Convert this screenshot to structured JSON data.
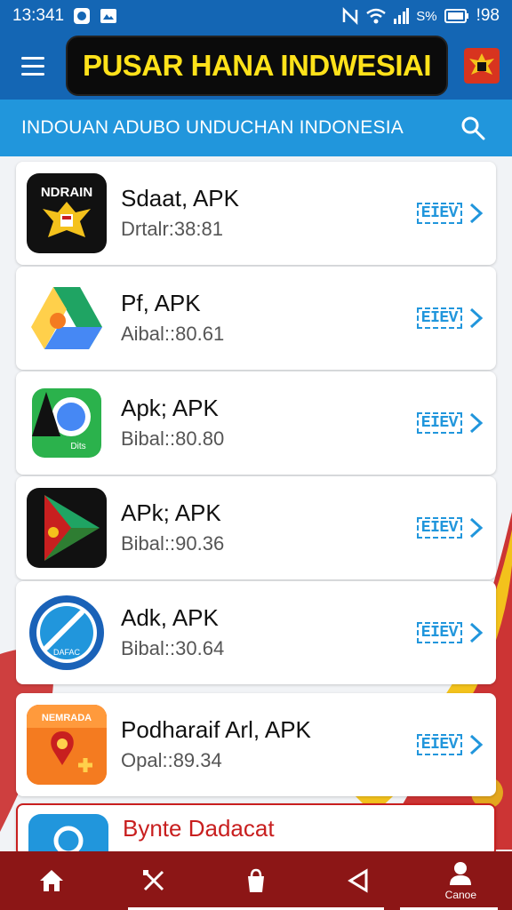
{
  "status_bar": {
    "time": "13:341",
    "battery": "98",
    "signal_pct": "S%"
  },
  "app_bar": {
    "title": "PUSAR HANA INDWESIAI",
    "menu_icon": "hamburger-icon",
    "emblem_icon": "garuda-emblem-icon"
  },
  "search_strip": {
    "label": "INDOUAN ADUBO UNDUCHAN INDONESIA",
    "icon": "search-icon"
  },
  "apps": [
    {
      "name": "Sdaat, APK",
      "meta": "Drtalr:38:81",
      "icon_text": "NDRAIN"
    },
    {
      "name": "Pf, APK",
      "meta": "Aibal::80.61"
    },
    {
      "name": "Apk; APK",
      "meta": "Bibal::80.80",
      "icon_text": "Dits"
    },
    {
      "name": "APk; APK",
      "meta": "Bibal::90.36"
    },
    {
      "name": "Adk, APK",
      "meta": "Bibal::30.64",
      "icon_text": "DAFAC"
    },
    {
      "name": "Podharaif Arl, APK",
      "meta": "Opal::89.34",
      "icon_text": "NEMRADA"
    },
    {
      "name": "Bynte Dadacat",
      "meta": ""
    }
  ],
  "download_label": "EIEV",
  "bottom_nav": {
    "account_label": "Canoe"
  },
  "colors": {
    "primary": "#1466b4",
    "accent": "#2196dc",
    "title_yellow": "#ffe21a",
    "nav_red": "#8c1616"
  }
}
